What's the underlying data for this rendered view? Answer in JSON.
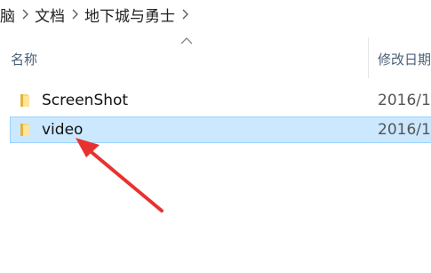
{
  "breadcrumb": {
    "items": [
      "脑",
      "文档",
      "地下城与勇士"
    ]
  },
  "columns": {
    "name": "名称",
    "date": "修改日期"
  },
  "files": [
    {
      "name": "ScreenShot",
      "date": "2016/1",
      "icon": "folder-icon",
      "selected": false
    },
    {
      "name": "video",
      "date": "2016/1",
      "icon": "folder-icon",
      "selected": true
    }
  ],
  "colors": {
    "selection_bg": "#cce8ff",
    "selection_border": "#99d1ff",
    "folder": "#f8d775",
    "annotation_arrow": "#e8322f"
  }
}
